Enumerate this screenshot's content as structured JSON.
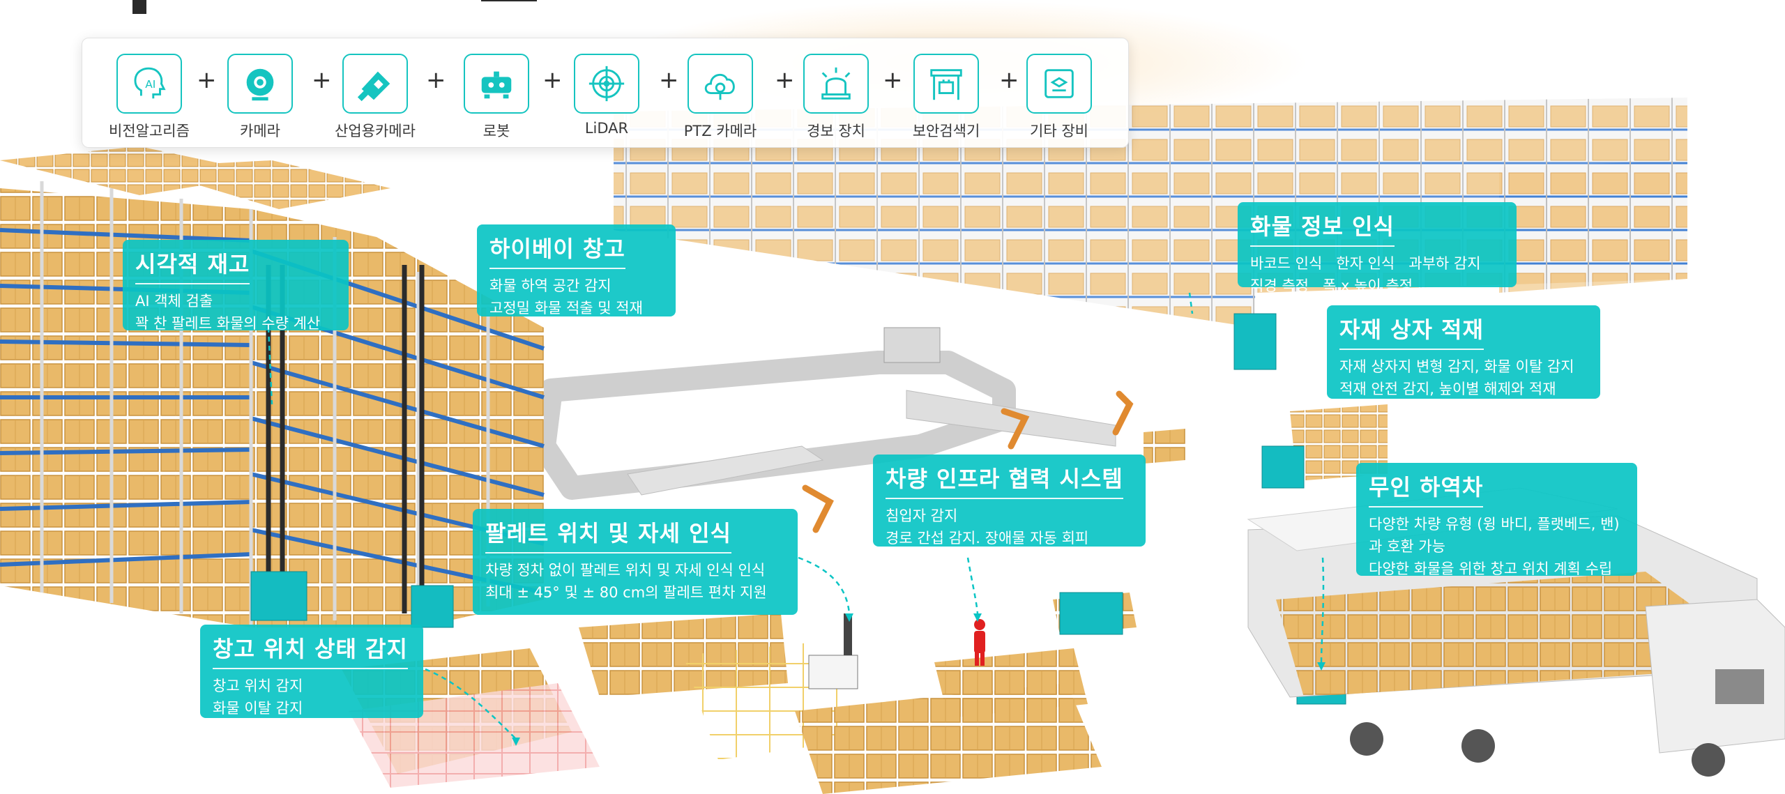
{
  "toolbar": {
    "items": [
      {
        "label": "비전알고리즘",
        "icon": "ai-head-icon"
      },
      {
        "label": "카메라",
        "icon": "camera-icon"
      },
      {
        "label": "산업용카메라",
        "icon": "industrial-camera-icon"
      },
      {
        "label": "로봇",
        "icon": "robot-icon"
      },
      {
        "label": "LiDAR",
        "icon": "lidar-icon"
      },
      {
        "label": "PTZ 카메라",
        "icon": "ptz-camera-icon"
      },
      {
        "label": "경보 장치",
        "icon": "alarm-icon"
      },
      {
        "label": "보안검색기",
        "icon": "security-scanner-icon"
      },
      {
        "label": "기타 장비",
        "icon": "other-device-icon"
      }
    ],
    "separator": "+"
  },
  "callouts": {
    "visual_inventory": {
      "title": "시각적 재고",
      "lines": [
        "AI 객체 검출",
        "꽉 찬 팔레트 화물의 수량 계산"
      ]
    },
    "highbay": {
      "title": "하이베이 창고",
      "lines": [
        "화물 하역 공간 감지",
        "고정밀 화물 적출 및 적재"
      ]
    },
    "cargo_info": {
      "title": "화물 정보 인식",
      "lines": [
        "바코드 인식   한자 인식   과부하 감지",
        "직경 측정   폭 x 높이 측정"
      ]
    },
    "box_stacking": {
      "title": "자재 상자 적재",
      "lines": [
        "자재 상자지 변형 감지, 화물 이탈 감지",
        "적재 안전 감지, 높이별 해제와 적재"
      ]
    },
    "v2x": {
      "title": "차량 인프라 협력 시스템",
      "lines": [
        "침입자 감지",
        "경로 간섭 감지. 장애물 자동 회피"
      ]
    },
    "unmanned_unloader": {
      "title": "무인 하역차",
      "lines": [
        "다양한 차량 유형 (윙 바디, 플랫베드, 밴)과 호환 가능",
        "다양한 화물을 위한 창고 위치 계획 수립"
      ]
    },
    "pallet_pose": {
      "title": "팔레트 위치 및 자세 인식",
      "lines": [
        "차량 정차 없이 팔레트 위치 및 자세 인식 인식",
        "최대 ± 45° 및 ± 80 cm의 팔레트 편차 지원"
      ]
    },
    "slot_status": {
      "title": "창고 위치 상태 감지",
      "lines": [
        "창고 위치 감지",
        "화물 이탈 감지"
      ]
    }
  },
  "colors": {
    "accent": "#0ac4c4",
    "box": "#e8b866",
    "rack_blue": "#2f6fc2",
    "floor_grid_red": "#f3a3a3",
    "floor_grid_yellow": "#f3d36b"
  }
}
